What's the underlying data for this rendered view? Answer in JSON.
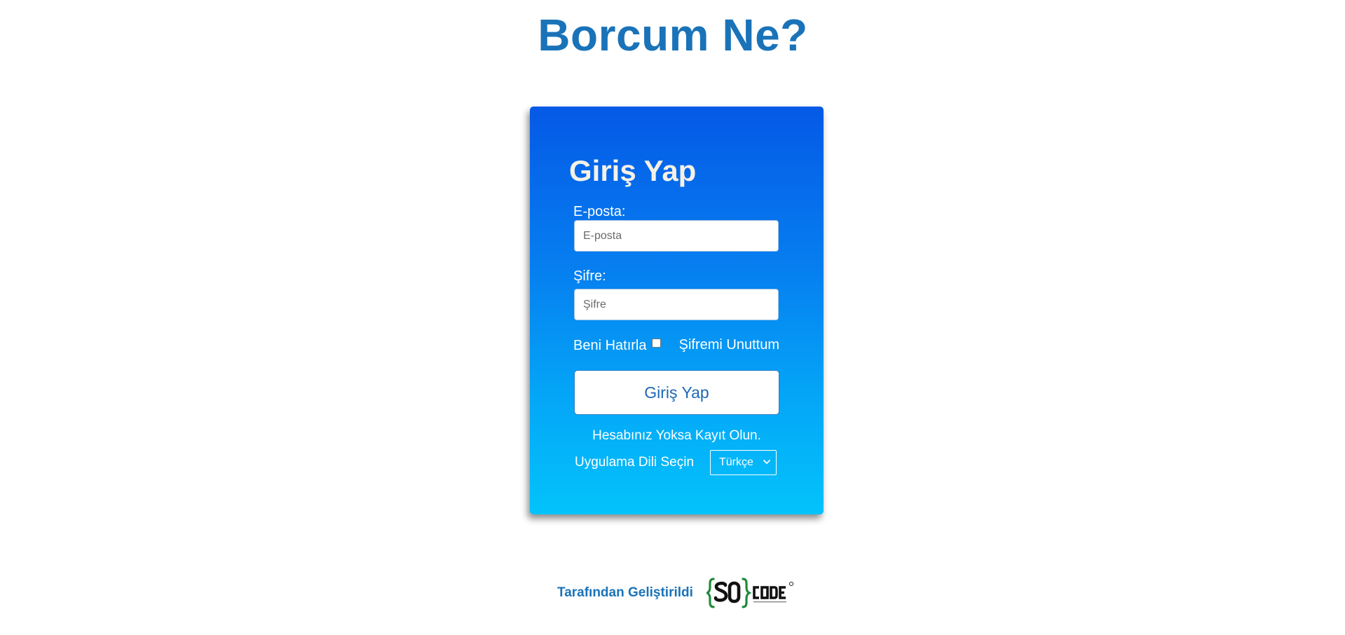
{
  "app": {
    "title": "Borcum Ne?"
  },
  "login": {
    "heading": "Giriş Yap",
    "email_label": "E-posta:",
    "email_placeholder": "E-posta",
    "email_value": "",
    "password_label": "Şifre:",
    "password_placeholder": "Şifre",
    "password_value": "",
    "remember_label": "Beni Hatırla",
    "remember_checked": false,
    "forgot_label": "Şifremi Unuttum",
    "submit_label": "Giriş Yap",
    "register_text": "Hesabınız Yoksa Kayıt Olun.",
    "language_label": "Uygulama Dili Seçin",
    "language_selected": "Türkçe"
  },
  "footer": {
    "developed_by": "Tarafından Geliştirildi",
    "logo_name": "socode-logo",
    "logo_text": "SO CODE"
  },
  "colors": {
    "brand_blue": "#1a73b8",
    "card_gradient_top": "#0559e6",
    "card_gradient_bottom": "#03c3fb",
    "logo_green": "#1f8a3a"
  }
}
